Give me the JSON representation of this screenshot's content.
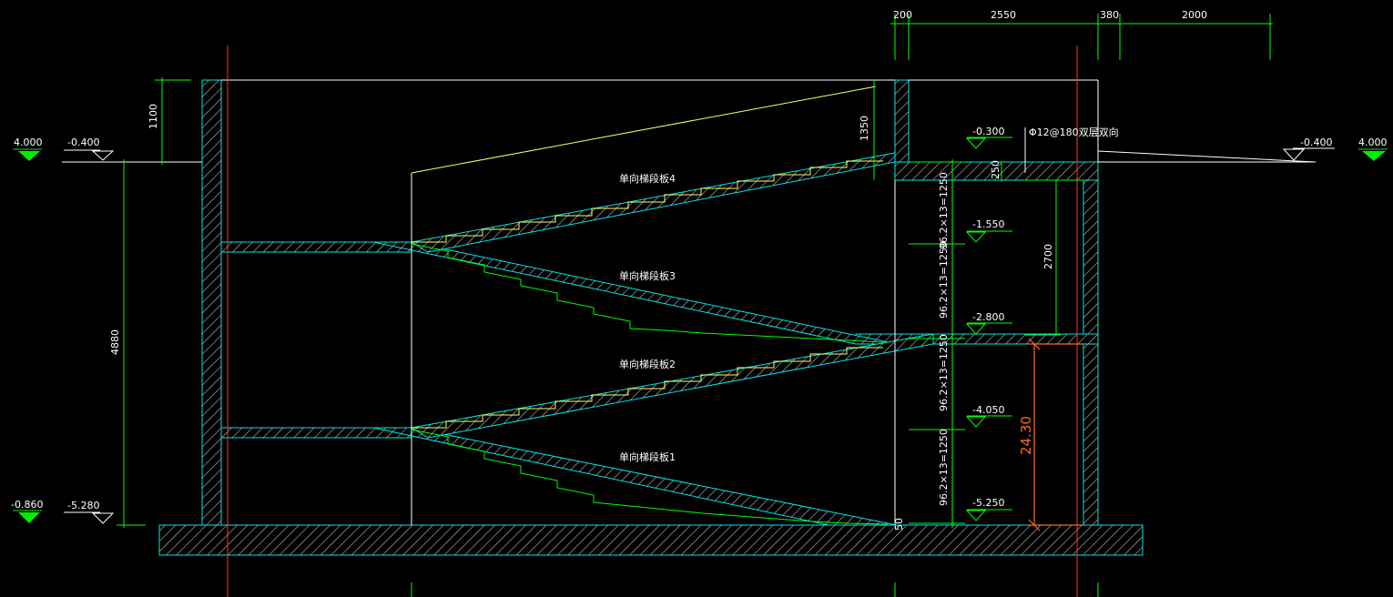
{
  "colors": {
    "background": "#000000",
    "wall_outline": "#00e5e5",
    "hatch": "#c8c8c8",
    "dimension": "#00ff00",
    "stair_yellow": "#ffff66",
    "axis_red": "#ff3030",
    "orange_dim": "#ff6a1a",
    "text": "#ffffff",
    "level_marker": "#00ee00",
    "white_line": "#ffffff"
  },
  "top_dims": [
    "200",
    "2550",
    "380",
    "2000"
  ],
  "left_dims": {
    "height_1100": "1100",
    "height_4880": "4880"
  },
  "right_dims": {
    "h1350": "1350",
    "h250": "250",
    "h2700": "2700",
    "h24_30": "24.30",
    "d50": "50"
  },
  "step_dims": [
    "96.2×13=1250",
    "96.2×13=1250",
    "96.2×13=1250",
    "96.2×13=1250"
  ],
  "levels": {
    "left_top_marker": "4.000",
    "left_top": "-0.400",
    "left_bottom_marker": "-0.860",
    "left_bottom": "-5.280",
    "right_top_marker": "4.000",
    "right_top": "-0.400",
    "r1": "-0.300",
    "r2": "-1.550",
    "r3": "-2.800",
    "r4": "-4.050",
    "r5": "-5.250"
  },
  "rebar_note": "Φ12@180双层双向",
  "stair_labels": [
    "单向梯段板4",
    "单向梯段板3",
    "单向梯段板2",
    "单向梯段板1"
  ]
}
